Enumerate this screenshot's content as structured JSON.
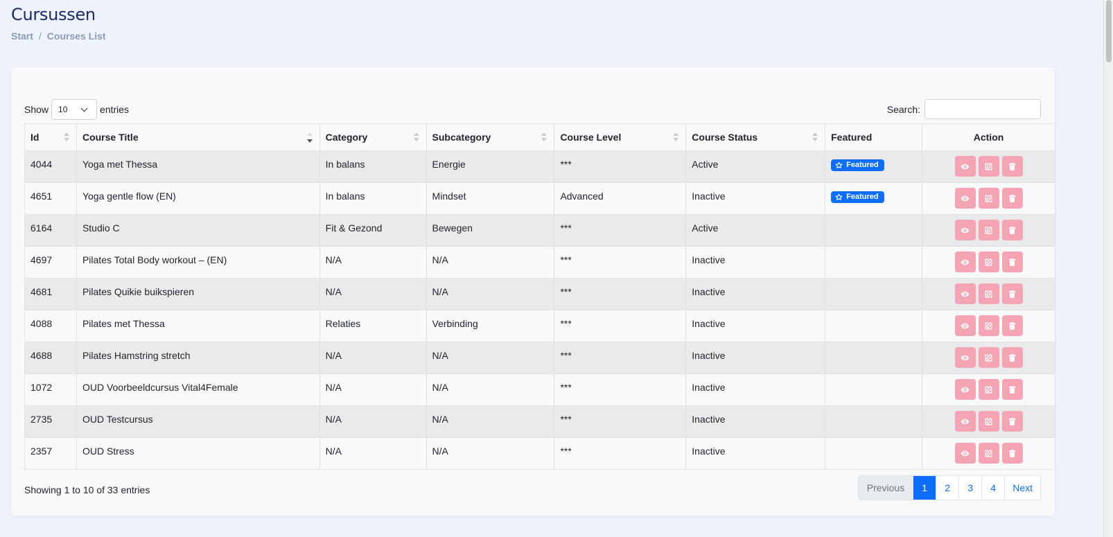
{
  "header": {
    "title": "Cursussen",
    "breadcrumb": [
      "Start",
      "Courses List"
    ]
  },
  "controls": {
    "show_label": "Show",
    "entries_label": "entries",
    "page_length": "10",
    "search_label": "Search:",
    "search_value": ""
  },
  "table": {
    "columns": [
      "Id",
      "Course Title",
      "Category",
      "Subcategory",
      "Course Level",
      "Course Status",
      "Featured",
      "Action"
    ],
    "rows": [
      {
        "id": "4044",
        "title": "Yoga met Thessa",
        "category": "In balans",
        "subcategory": "Energie",
        "level": "***",
        "status": "Active",
        "featured": "Featured"
      },
      {
        "id": "4651",
        "title": "Yoga gentle flow (EN)",
        "category": "In balans",
        "subcategory": "Mindset",
        "level": "Advanced",
        "status": "Inactive",
        "featured": "Featured"
      },
      {
        "id": "6164",
        "title": "Studio C",
        "category": "Fit & Gezond",
        "subcategory": "Bewegen",
        "level": "***",
        "status": "Active",
        "featured": ""
      },
      {
        "id": "4697",
        "title": "Pilates Total Body workout – (EN)",
        "category": "N/A",
        "subcategory": "N/A",
        "level": "***",
        "status": "Inactive",
        "featured": ""
      },
      {
        "id": "4681",
        "title": "Pilates Quikie buikspieren",
        "category": "N/A",
        "subcategory": "N/A",
        "level": "***",
        "status": "Inactive",
        "featured": ""
      },
      {
        "id": "4088",
        "title": "Pilates met Thessa",
        "category": "Relaties",
        "subcategory": "Verbinding",
        "level": "***",
        "status": "Inactive",
        "featured": ""
      },
      {
        "id": "4688",
        "title": "Pilates Hamstring stretch",
        "category": "N/A",
        "subcategory": "N/A",
        "level": "***",
        "status": "Inactive",
        "featured": ""
      },
      {
        "id": "1072",
        "title": "OUD Voorbeeldcursus Vital4Female",
        "category": "N/A",
        "subcategory": "N/A",
        "level": "***",
        "status": "Inactive",
        "featured": ""
      },
      {
        "id": "2735",
        "title": "OUD Testcursus",
        "category": "N/A",
        "subcategory": "N/A",
        "level": "***",
        "status": "Inactive",
        "featured": ""
      },
      {
        "id": "2357",
        "title": "OUD Stress",
        "category": "N/A",
        "subcategory": "N/A",
        "level": "***",
        "status": "Inactive",
        "featured": ""
      }
    ]
  },
  "footer": {
    "info": "Showing 1 to 10 of 33 entries",
    "pagination": {
      "previous": "Previous",
      "pages": [
        "1",
        "2",
        "3",
        "4"
      ],
      "active_page": "1",
      "next": "Next"
    }
  },
  "colors": {
    "primary": "#0d6efd",
    "action_button": "#f4a4b3",
    "title": "#1b2a6e",
    "breadcrumb": "#8a9bb8"
  },
  "icons": {
    "featured": "star-icon",
    "view": "eye-icon",
    "edit": "edit-icon",
    "delete": "trash-icon",
    "length_dropdown": "chevron-down-icon"
  }
}
